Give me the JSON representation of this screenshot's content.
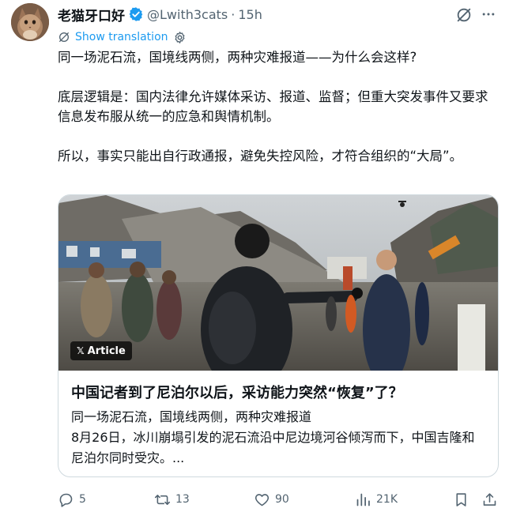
{
  "post": {
    "display_name": "老猫牙口好",
    "handle": "@Lwith3cats",
    "separator": "·",
    "time": "15h",
    "show_translation": "Show translation",
    "paragraphs": [
      "同一场泥石流，国境线两侧，两种灾难报道——为什么会这样?",
      "底层逻辑是：国内法律允许媒体采访、报道、监督；但重大突发事件又要求信息发布服从统一的应急和舆情机制。",
      "所以，事实只能出自行政通报，避免失控风险，才符合组织的“大局”。"
    ]
  },
  "card": {
    "badge_x": "𝕏",
    "badge_label": "Article",
    "title": "中国记者到了尼泊尔以后，采访能力突然“恢复”了？",
    "desc_line1": "同一场泥石流，国境线两侧，两种灾难报道",
    "desc_line2": "8月26日，冰川崩塌引发的泥石流沿中尼边境河谷倾泻而下，中国吉隆和尼泊尔同时受灾。..."
  },
  "actions": {
    "replies": "5",
    "reposts": "13",
    "likes": "90",
    "views": "21K"
  },
  "colors": {
    "accent": "#1d9bf0",
    "muted": "#536471",
    "text": "#0f1419",
    "border": "#cfd9de"
  },
  "icons": [
    "verified-badge-icon",
    "grok-icon",
    "more-icon",
    "translate-icon",
    "gear-icon",
    "reply-icon",
    "retweet-icon",
    "heart-icon",
    "views-icon",
    "bookmark-icon",
    "share-icon"
  ]
}
